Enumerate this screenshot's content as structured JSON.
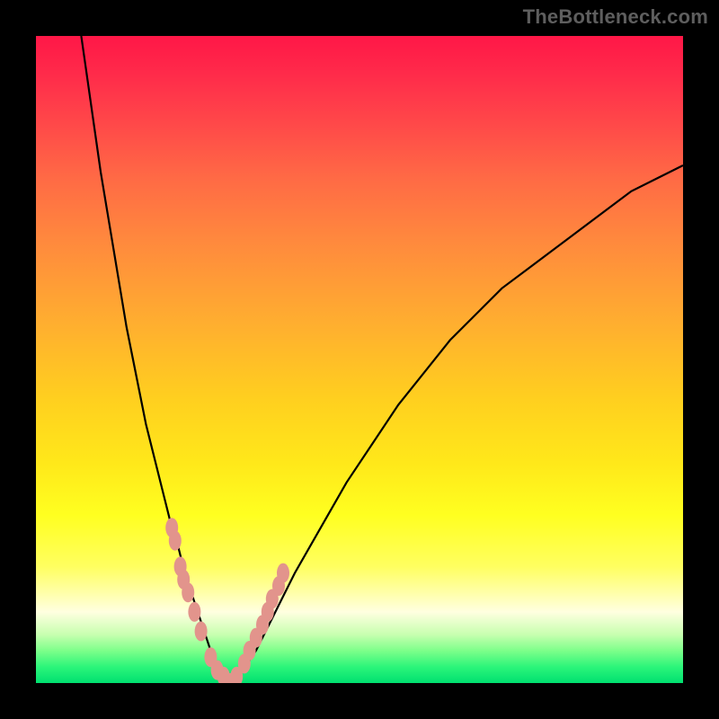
{
  "watermark": "TheBottleneck.com",
  "colors": {
    "background": "#000000",
    "curve_stroke": "#000000",
    "marker_fill": "#e2948c"
  },
  "chart_data": {
    "type": "line",
    "title": "",
    "xlabel": "",
    "ylabel": "",
    "xlim": [
      0,
      100
    ],
    "ylim": [
      0,
      100
    ],
    "series": [
      {
        "name": "bottleneck-curve",
        "x": [
          7,
          8,
          9,
          10,
          11,
          12,
          13,
          14,
          15,
          16,
          17,
          18,
          19,
          20,
          21,
          22,
          23,
          24,
          25,
          26,
          27,
          28,
          29,
          30,
          32,
          34,
          36,
          38,
          40,
          44,
          48,
          52,
          56,
          60,
          64,
          68,
          72,
          76,
          80,
          84,
          88,
          92,
          96,
          100
        ],
        "y": [
          100,
          93,
          86,
          79,
          73,
          67,
          61,
          55,
          50,
          45,
          40,
          36,
          32,
          28,
          24,
          21,
          17,
          14,
          11,
          8,
          5,
          3,
          1,
          0,
          2,
          5,
          9,
          13,
          17,
          24,
          31,
          37,
          43,
          48,
          53,
          57,
          61,
          64,
          67,
          70,
          73,
          76,
          78,
          80
        ]
      }
    ],
    "markers": {
      "name": "highlight-points",
      "x": [
        21,
        21.5,
        22.3,
        22.8,
        23.5,
        24.5,
        25.5,
        27,
        28,
        29,
        30,
        31,
        32.2,
        33,
        34,
        35,
        35.8,
        36.5,
        37.5,
        38.2
      ],
      "y": [
        24,
        22,
        18,
        16,
        14,
        11,
        8,
        4,
        2,
        1,
        0,
        1,
        3,
        5,
        7,
        9,
        11,
        13,
        15,
        17
      ]
    }
  }
}
